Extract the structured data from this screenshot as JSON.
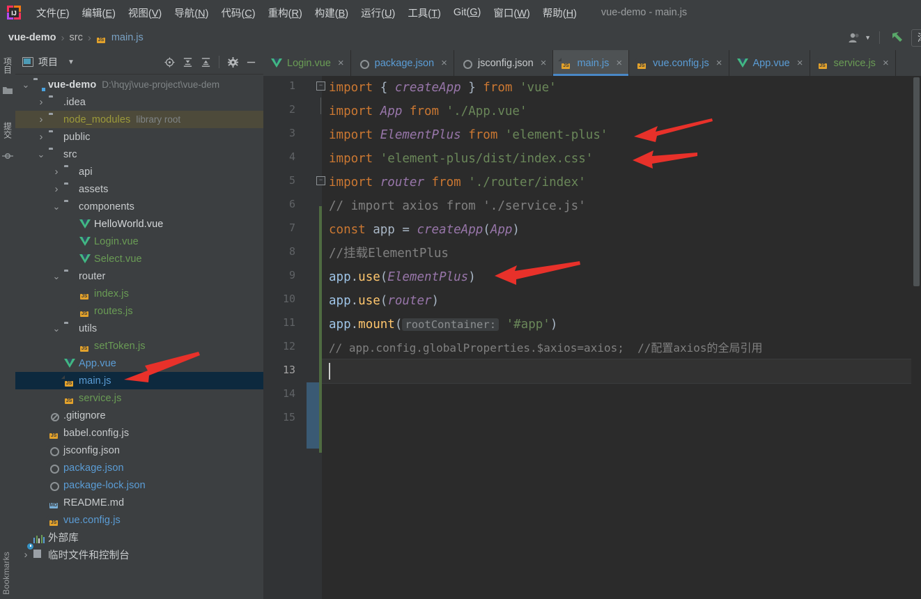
{
  "window": {
    "title": "vue-demo - main.js"
  },
  "menubar": {
    "items": [
      {
        "label": "文件(F)",
        "name": "menu-file"
      },
      {
        "label": "编辑(E)",
        "name": "menu-edit"
      },
      {
        "label": "视图(V)",
        "name": "menu-view"
      },
      {
        "label": "导航(N)",
        "name": "menu-navigate"
      },
      {
        "label": "代码(C)",
        "name": "menu-code"
      },
      {
        "label": "重构(R)",
        "name": "menu-refactor"
      },
      {
        "label": "构建(B)",
        "name": "menu-build"
      },
      {
        "label": "运行(U)",
        "name": "menu-run"
      },
      {
        "label": "工具(T)",
        "name": "menu-tools"
      },
      {
        "label": "Git(G)",
        "name": "menu-git"
      },
      {
        "label": "窗口(W)",
        "name": "menu-window"
      },
      {
        "label": "帮助(H)",
        "name": "menu-help"
      }
    ]
  },
  "breadcrumb": {
    "project": "vue-demo",
    "folder": "src",
    "file": "main.js",
    "separator": "›"
  },
  "navbar_right": {
    "add_config_label": "添"
  },
  "left_strip": {
    "project_label": "项目",
    "commit_label": "提交",
    "bookmarks_label": "Bookmarks"
  },
  "project_pane": {
    "title": "项目",
    "tools": [
      "locate-icon",
      "expand-all-icon",
      "collapse-all-icon",
      "settings-icon",
      "hide-icon"
    ]
  },
  "tree": [
    {
      "label": "vue-demo",
      "sub": "D:\\hqyj\\vue-project\\vue-dem",
      "indent": 0,
      "arrow": "down",
      "icon": "folder-module",
      "color": "c-white",
      "bold": true,
      "selected": false
    },
    {
      "label": ".idea",
      "sub": "",
      "indent": 1,
      "arrow": "right",
      "icon": "folder",
      "color": "c-default",
      "bold": false,
      "selected": false
    },
    {
      "label": "node_modules",
      "sub": "library root",
      "indent": 1,
      "arrow": "right",
      "icon": "folder",
      "color": "c-olive",
      "bold": false,
      "selected": false,
      "highlight": true
    },
    {
      "label": "public",
      "sub": "",
      "indent": 1,
      "arrow": "right",
      "icon": "folder",
      "color": "c-default",
      "bold": false,
      "selected": false
    },
    {
      "label": "src",
      "sub": "",
      "indent": 1,
      "arrow": "down",
      "icon": "folder",
      "color": "c-default",
      "bold": false,
      "selected": false
    },
    {
      "label": "api",
      "sub": "",
      "indent": 2,
      "arrow": "right",
      "icon": "folder",
      "color": "c-default",
      "bold": false,
      "selected": false
    },
    {
      "label": "assets",
      "sub": "",
      "indent": 2,
      "arrow": "right",
      "icon": "folder",
      "color": "c-default",
      "bold": false,
      "selected": false
    },
    {
      "label": "components",
      "sub": "",
      "indent": 2,
      "arrow": "down",
      "icon": "folder",
      "color": "c-default",
      "bold": false,
      "selected": false
    },
    {
      "label": "HelloWorld.vue",
      "sub": "",
      "indent": 3,
      "arrow": "none",
      "icon": "vue",
      "color": "c-white",
      "bold": false,
      "selected": false
    },
    {
      "label": "Login.vue",
      "sub": "",
      "indent": 3,
      "arrow": "none",
      "icon": "vue",
      "color": "c-green",
      "bold": false,
      "selected": false
    },
    {
      "label": "Select.vue",
      "sub": "",
      "indent": 3,
      "arrow": "none",
      "icon": "vue",
      "color": "c-green",
      "bold": false,
      "selected": false
    },
    {
      "label": "router",
      "sub": "",
      "indent": 2,
      "arrow": "down",
      "icon": "folder",
      "color": "c-default",
      "bold": false,
      "selected": false
    },
    {
      "label": "index.js",
      "sub": "",
      "indent": 3,
      "arrow": "none",
      "icon": "js",
      "color": "c-green",
      "bold": false,
      "selected": false
    },
    {
      "label": "routes.js",
      "sub": "",
      "indent": 3,
      "arrow": "none",
      "icon": "js",
      "color": "c-green",
      "bold": false,
      "selected": false
    },
    {
      "label": "utils",
      "sub": "",
      "indent": 2,
      "arrow": "down",
      "icon": "folder",
      "color": "c-default",
      "bold": false,
      "selected": false
    },
    {
      "label": "setToken.js",
      "sub": "",
      "indent": 3,
      "arrow": "none",
      "icon": "js",
      "color": "c-green",
      "bold": false,
      "selected": false
    },
    {
      "label": "App.vue",
      "sub": "",
      "indent": 2,
      "arrow": "none",
      "icon": "vue",
      "color": "c-blue",
      "bold": false,
      "selected": false
    },
    {
      "label": "main.js",
      "sub": "",
      "indent": 2,
      "arrow": "none",
      "icon": "js",
      "color": "c-blue",
      "bold": false,
      "selected": true
    },
    {
      "label": "service.js",
      "sub": "",
      "indent": 2,
      "arrow": "none",
      "icon": "js",
      "color": "c-green",
      "bold": false,
      "selected": false
    },
    {
      "label": ".gitignore",
      "sub": "",
      "indent": 1,
      "arrow": "none",
      "icon": "gitignore",
      "color": "c-default",
      "bold": false,
      "selected": false
    },
    {
      "label": "babel.config.js",
      "sub": "",
      "indent": 1,
      "arrow": "none",
      "icon": "js",
      "color": "c-default",
      "bold": false,
      "selected": false
    },
    {
      "label": "jsconfig.json",
      "sub": "",
      "indent": 1,
      "arrow": "none",
      "icon": "json",
      "color": "c-default",
      "bold": false,
      "selected": false
    },
    {
      "label": "package.json",
      "sub": "",
      "indent": 1,
      "arrow": "none",
      "icon": "json",
      "color": "c-blue",
      "bold": false,
      "selected": false
    },
    {
      "label": "package-lock.json",
      "sub": "",
      "indent": 1,
      "arrow": "none",
      "icon": "json",
      "color": "c-blue",
      "bold": false,
      "selected": false
    },
    {
      "label": "README.md",
      "sub": "",
      "indent": 1,
      "arrow": "none",
      "icon": "md",
      "color": "c-default",
      "bold": false,
      "selected": false
    },
    {
      "label": "vue.config.js",
      "sub": "",
      "indent": 1,
      "arrow": "none",
      "icon": "js",
      "color": "c-blue",
      "bold": false,
      "selected": false
    },
    {
      "label": "外部库",
      "sub": "",
      "indent": 0,
      "arrow": "none",
      "icon": "library",
      "color": "c-default",
      "bold": false,
      "selected": false
    },
    {
      "label": "临时文件和控制台",
      "sub": "",
      "indent": 0,
      "arrow": "right",
      "icon": "scratch",
      "color": "c-default",
      "bold": false,
      "selected": false
    }
  ],
  "tabs": [
    {
      "label": "Login.vue",
      "icon": "vue",
      "style": "vue",
      "active": false,
      "close": "×"
    },
    {
      "label": "package.json",
      "icon": "json",
      "style": "json",
      "active": false,
      "close": "×"
    },
    {
      "label": "jsconfig.json",
      "icon": "json",
      "style": "jsonw",
      "active": false,
      "close": "×"
    },
    {
      "label": "main.js",
      "icon": "js",
      "style": "js",
      "active": true,
      "close": "×"
    },
    {
      "label": "vue.config.js",
      "icon": "js",
      "style": "js",
      "active": false,
      "close": "×"
    },
    {
      "label": "App.vue",
      "icon": "vue",
      "style": "js",
      "active": false,
      "close": "×"
    },
    {
      "label": "service.js",
      "icon": "js",
      "style": "greenjs",
      "active": false,
      "close": "×"
    }
  ],
  "editor": {
    "file": "main.js",
    "line_numbers": [
      "1",
      "2",
      "3",
      "4",
      "5",
      "6",
      "7",
      "8",
      "9",
      "10",
      "11",
      "12",
      "13",
      "14",
      "15"
    ],
    "current_line": 13,
    "inlay_hint": "rootContainer:",
    "lines": [
      "import { createApp } from 'vue'",
      "import App from './App.vue'",
      "import ElementPlus from 'element-plus'",
      "import 'element-plus/dist/index.css'",
      "import router from './router/index'",
      "// import axios from './service.js'",
      "const app = createApp(App)",
      "//挂载ElementPlus",
      "app.use(ElementPlus)",
      "app.use(router)",
      "app.mount( rootContainer: '#app')",
      "// app.config.globalProperties.$axios=axios;  //配置axios的全局引用",
      "",
      "",
      ""
    ]
  },
  "annotations": {
    "arrow_color": "#e8312a",
    "arrows": [
      {
        "name": "arrow-element-plus-import"
      },
      {
        "name": "arrow-element-plus-css-import"
      },
      {
        "name": "arrow-app-use-elementplus"
      },
      {
        "name": "arrow-main-js-file"
      }
    ]
  },
  "colors": {
    "accent": "#4a88c7",
    "selection": "#0d293e",
    "editor_bg": "#2b2b2b",
    "panel_bg": "#3c3f41"
  }
}
